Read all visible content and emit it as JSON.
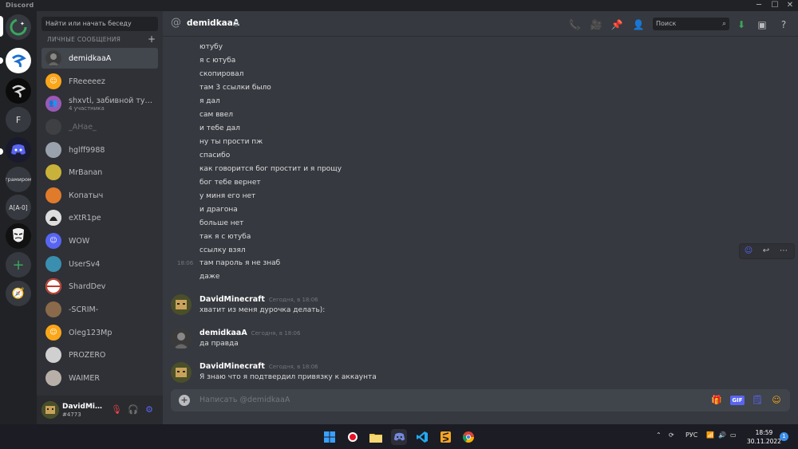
{
  "app": {
    "brand": "Discord"
  },
  "window_controls": {
    "minimize": "─",
    "maximize": "☐",
    "close": "✕"
  },
  "dm_sidebar": {
    "search_placeholder": "Найти или начать беседу",
    "section_title": "ЛИЧНЫЕ СООБЩЕНИЯ",
    "add_label": "+",
    "items": [
      {
        "name": "demidkaaA",
        "active": true
      },
      {
        "name": "FReeeeez"
      },
      {
        "name": "shxvti, забивной туба...",
        "sub": "4 участника"
      },
      {
        "name": "_AHae_"
      },
      {
        "name": "hglff9988"
      },
      {
        "name": "MrBanan"
      },
      {
        "name": "Копатыч"
      },
      {
        "name": "eXtR1pe"
      },
      {
        "name": "WOW"
      },
      {
        "name": "UserSv4"
      },
      {
        "name": "ShardDev"
      },
      {
        "name": "-SCRIM-"
      },
      {
        "name": "Oleg123Mp"
      },
      {
        "name": "PROZERO"
      },
      {
        "name": "WAIMER"
      }
    ]
  },
  "servers": [
    {
      "label": ""
    },
    {
      "label": ""
    },
    {
      "label": ""
    },
    {
      "label": "F"
    },
    {
      "label": ""
    },
    {
      "label": "грамиром"
    },
    {
      "label": "A[A-0]"
    },
    {
      "label": ""
    }
  ],
  "user_panel": {
    "name": "DavidMinecraft",
    "tag": "#4773"
  },
  "chat": {
    "channel_name": "demidkaaA",
    "search_placeholder": "Поиск",
    "lines": [
      "ютубу",
      "я с ютуба",
      "скопировал",
      "там 3 ссылки было",
      "я дал",
      "сам ввел",
      "и тебе дал",
      "ну ты прости пж",
      "спасибо",
      "как говорится бог простит и я прощу",
      "бог тебе вернет",
      "у миня его нет",
      "и драгона",
      "больше нет",
      "так я с ютуба",
      "ссылку взял",
      "там пароль я не знаб",
      "даже"
    ],
    "hover_time": "18:06",
    "groups": [
      {
        "author": "DavidMinecraft",
        "time": "Сегодня, в 18:06",
        "text": "хватит из меня дурочка делать):"
      },
      {
        "author": "demidkaaA",
        "time": "Сегодня, в 18:06",
        "text": "да правда"
      },
      {
        "author": "DavidMinecraft",
        "time": "Сегодня, в 18:06",
        "text": "Я знаю что я подтвердил привязку к аккаунта"
      }
    ],
    "composer_placeholder": "Написать @demidkaaA",
    "gif_label": "GIF"
  },
  "taskbar": {
    "language": "РУС",
    "time": "18:59",
    "date": "30.11.2022",
    "notifications": "1"
  },
  "colors": {
    "accent": "#5865f2",
    "bg_main": "#36393f",
    "bg_side": "#2f3136",
    "bg_rail": "#202225"
  }
}
